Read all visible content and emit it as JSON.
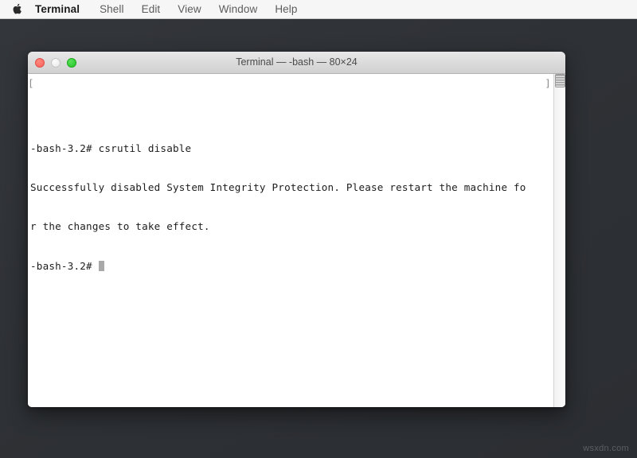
{
  "menubar": {
    "apple_icon": "apple-logo-icon",
    "items": [
      {
        "label": "Terminal",
        "active": true
      },
      {
        "label": "Shell",
        "active": false
      },
      {
        "label": "Edit",
        "active": false
      },
      {
        "label": "View",
        "active": false
      },
      {
        "label": "Window",
        "active": false
      },
      {
        "label": "Help",
        "active": false
      }
    ]
  },
  "window": {
    "title": "Terminal — -bash — 80×24",
    "controls": {
      "close_label": "close-button",
      "minimize_label": "minimize-button",
      "zoom_label": "zoom-button"
    },
    "terminal": {
      "lines": [
        "-bash-3.2# csrutil disable",
        "Successfully disabled System Integrity Protection. Please restart the machine fo",
        "r the changes to take effect.",
        "-bash-3.2# "
      ],
      "prompt": "-bash-3.2#",
      "command": "csrutil disable",
      "left_edge_marker": "[",
      "right_edge_marker": "]",
      "cursor": "block"
    }
  },
  "watermark": {
    "text": "wsxdn.com"
  },
  "colors": {
    "desktop_background": "#2e3135",
    "menubar_background": "#f6f6f6",
    "terminal_background": "#ffffff",
    "terminal_text": "#1d1d1d",
    "close_button": "#fb6158",
    "minimize_button": "#e6e6e6",
    "zoom_button": "#22c522",
    "cursor": "#a9a9a9"
  }
}
